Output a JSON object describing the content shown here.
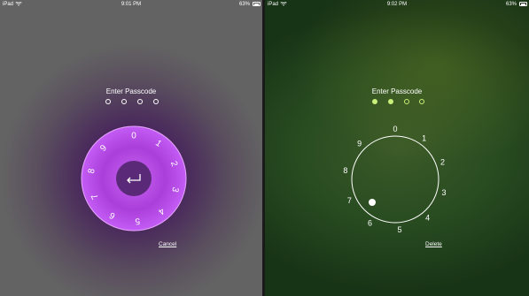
{
  "left": {
    "status": {
      "device": "iPad",
      "time": "9:01 PM",
      "battery": "63%"
    },
    "title": "Enter Passcode",
    "dots": [
      false,
      false,
      false,
      false
    ],
    "dial_digits": [
      "0",
      "1",
      "2",
      "3",
      "4",
      "5",
      "6",
      "7",
      "8",
      "9"
    ],
    "action_label": "Cancel"
  },
  "right": {
    "status": {
      "device": "iPad",
      "time": "9:02 PM",
      "battery": "63%"
    },
    "title": "Enter Passcode",
    "dots": [
      true,
      true,
      false,
      false
    ],
    "dial_digits": [
      "0",
      "1",
      "2",
      "3",
      "4",
      "5",
      "6",
      "7",
      "8",
      "9"
    ],
    "action_label": "Delete"
  },
  "colors": {
    "accent_purple": "#c75cf0",
    "accent_green": "#c9f07a"
  }
}
